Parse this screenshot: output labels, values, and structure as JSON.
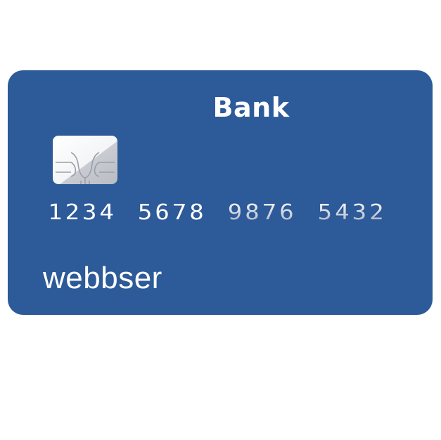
{
  "card": {
    "bank_name": "Bank",
    "number_groups": [
      "1234",
      "5678",
      "9876",
      "5432"
    ],
    "brand": "webbser",
    "colors": {
      "card_background": "#2d5a98",
      "text": "#ffffff"
    },
    "chip_icon": "emv-chip-icon"
  }
}
